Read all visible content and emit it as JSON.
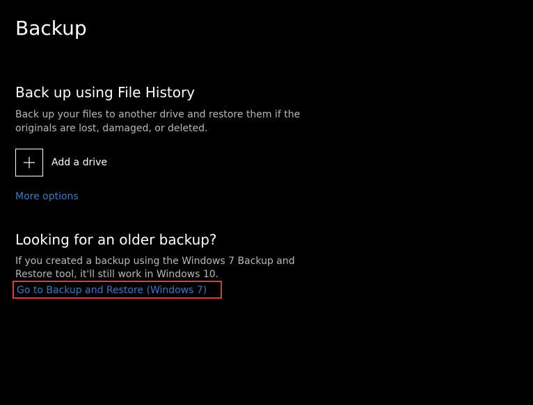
{
  "page_title": "Backup",
  "file_history": {
    "title": "Back up using File History",
    "description": "Back up your files to another drive and restore them if the originals are lost, damaged, or deleted.",
    "add_drive_label": "Add a drive",
    "more_options_label": "More options"
  },
  "older_backup": {
    "title": "Looking for an older backup?",
    "description": "If you created a backup using the Windows 7 Backup and Restore tool, it'll still work in Windows 10.",
    "link_label": "Go to Backup and Restore (Windows 7)"
  },
  "colors": {
    "link": "#3f78c3",
    "highlight": "#e53935"
  }
}
